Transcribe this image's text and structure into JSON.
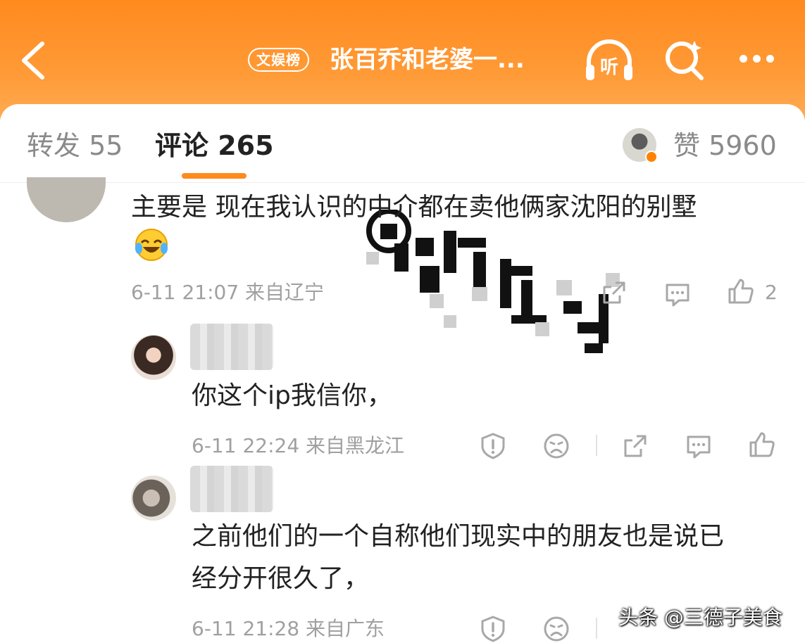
{
  "header": {
    "badge": "文娱榜",
    "title": "张百乔和老婆一...",
    "listen_label": "听",
    "icons": [
      "back-arrow-icon",
      "listen-icon",
      "search-icon",
      "more-icon"
    ],
    "colors": {
      "gradient_top": "#ff8a1e",
      "gradient_bottom": "#ffab52"
    }
  },
  "tabs": {
    "repost": "转发 55",
    "comments": "评论 265",
    "likes": "赞 5960",
    "active": "comments",
    "accent": "#ff8a1e"
  },
  "comments": [
    {
      "text": "主要是 现在我认识的中介都在卖他俩家沈阳的别墅",
      "emoji": "laughing-crying-emoji",
      "meta": "6-11 21:07 来自辽宁",
      "like_count": "2"
    },
    {
      "text": "你这个ip我信你，",
      "meta": "6-11 22:24 来自黑龙江"
    },
    {
      "text_line1": "之前他们的一个自称他们现实中的朋友也是说已",
      "text_line2": "经分开很久了，",
      "meta": "6-11 21:28 来自广东"
    }
  ],
  "watermark": "头条 @三德子美食"
}
